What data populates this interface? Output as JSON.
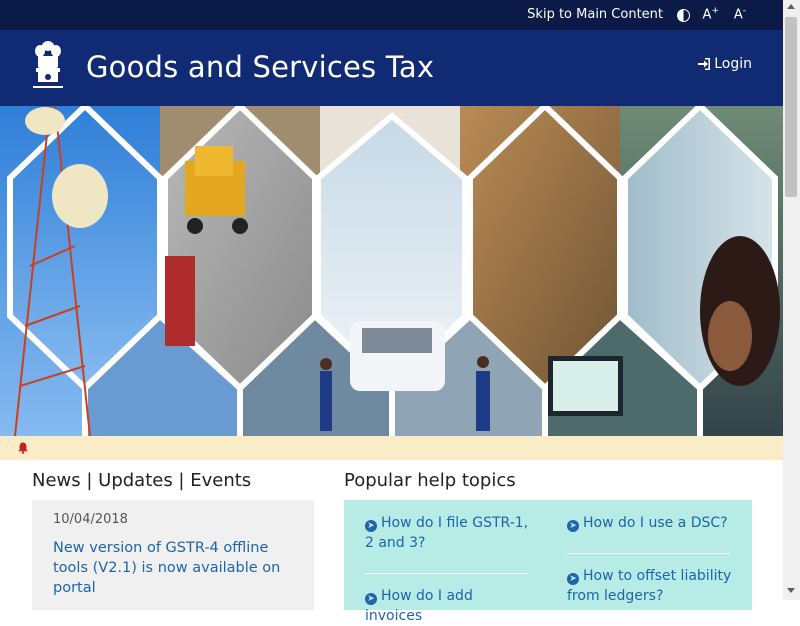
{
  "topbar": {
    "skip_label": "Skip to Main Content",
    "font_increase": "A+",
    "font_decrease": "A-"
  },
  "header": {
    "title": "Goods and Services Tax",
    "login_label": "Login"
  },
  "news": {
    "heading": "News | Updates | Events",
    "date": "10/04/2018",
    "link_text": "New version of GSTR-4 offline tools (V2.1) is now available on portal"
  },
  "help": {
    "heading": "Popular help topics",
    "items": [
      "How do I file GSTR-1, 2 and 3?",
      "How do I use a DSC?",
      "How do I add invoices",
      "How to offset liability from ledgers?"
    ]
  },
  "colors": {
    "topbar": "#0b1a47",
    "header": "#102a73",
    "alert": "#fbecc8",
    "help_bg": "#b6ebe6",
    "link": "#1e64a8"
  }
}
